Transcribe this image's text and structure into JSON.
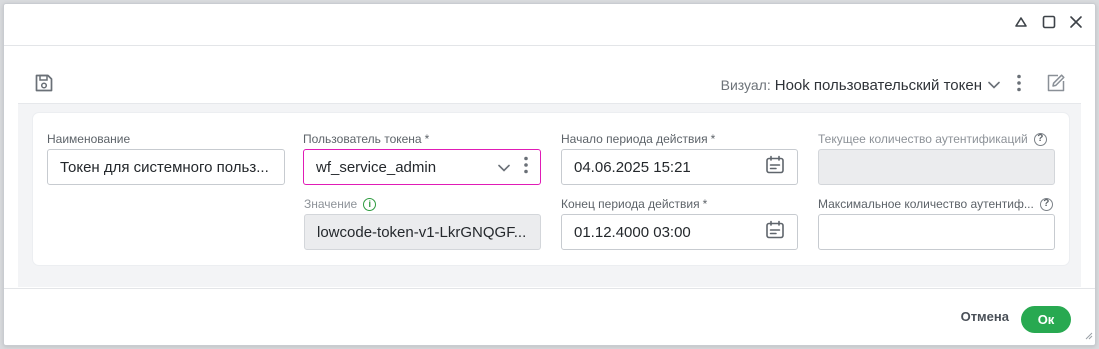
{
  "window": {
    "controls": [
      "collapse-icon",
      "maximize-icon",
      "close-icon"
    ]
  },
  "toolbar": {
    "visual_label": "Визуал:",
    "visual_value": "Hook пользовательский токен",
    "icons": [
      "save-icon",
      "chevron-down-icon",
      "kebab-icon",
      "edit-icon"
    ]
  },
  "form": {
    "name": {
      "label": "Наименование",
      "value": "Токен для системного польз..."
    },
    "token_user": {
      "label": "Пользователь токена",
      "required": "*",
      "value": "wf_service_admin"
    },
    "value": {
      "label": "Значение",
      "value": "lowcode-token-v1-LkrGNQGF..."
    },
    "start": {
      "label": "Начало периода действия",
      "required": "*",
      "value": "04.06.2025 15:21"
    },
    "end": {
      "label": "Конец периода действия",
      "required": "*",
      "value": "01.12.4000 03:00"
    },
    "current_auth": {
      "label": "Текущее количество аутентификаций",
      "help": "?",
      "value": ""
    },
    "max_auth": {
      "label": "Максимальное количество аутентиф...",
      "help": "?",
      "value": ""
    },
    "info_mark": "i"
  },
  "footer": {
    "cancel": "Отмена",
    "ok": "Ок"
  },
  "colors": {
    "accent_green": "#28a951",
    "focus_magenta": "#e01bb6",
    "info_green": "#2e9b3f"
  }
}
